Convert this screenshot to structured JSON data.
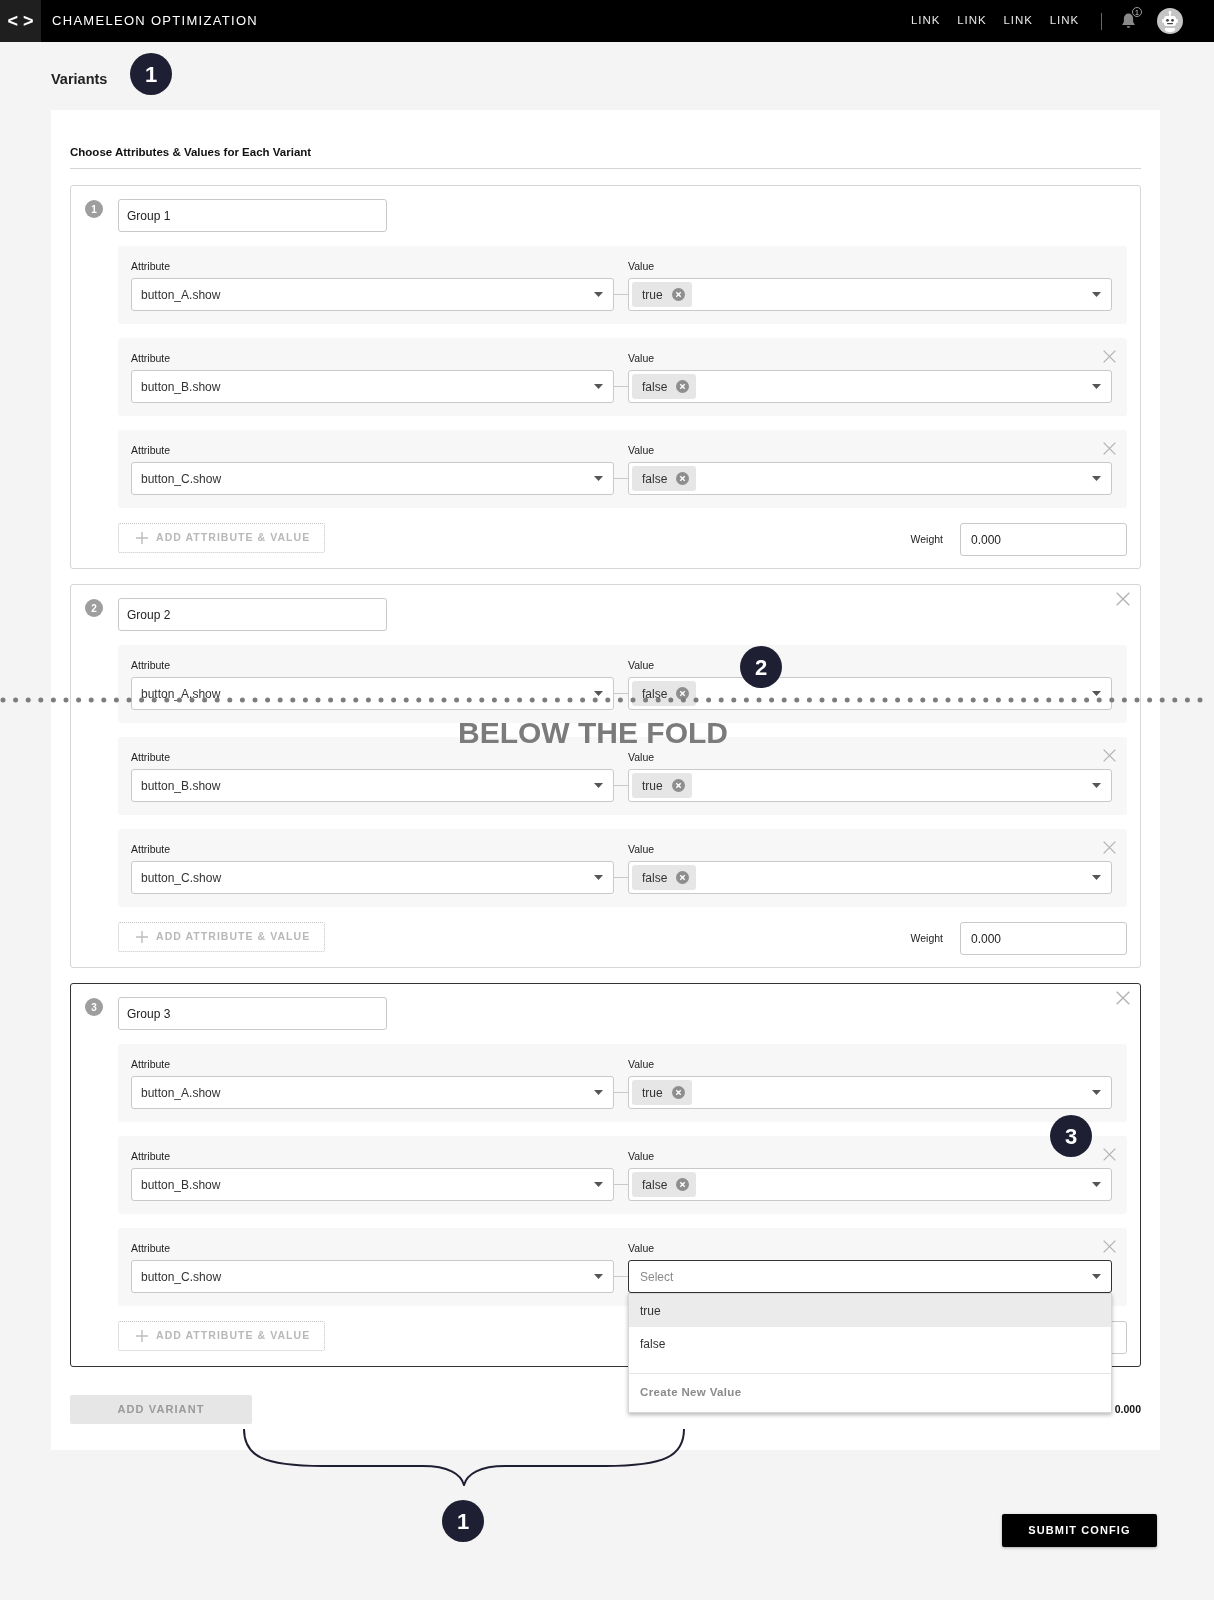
{
  "header": {
    "logo": "< >",
    "title": "CHAMELEON OPTIMIZATION",
    "links": [
      "LINK",
      "LINK",
      "LINK",
      "LINK"
    ],
    "notification_count": "1"
  },
  "page": {
    "title": "Variants"
  },
  "variants_card": {
    "heading": "Choose Attributes & Values for Each Variant",
    "groups": [
      {
        "number": "1",
        "name": "Group 1",
        "active": false,
        "removable": false,
        "rows": [
          {
            "attribute_label": "Attribute",
            "attribute": "button_A.show",
            "value_label": "Value",
            "value": "true",
            "removable": false,
            "expanded": false
          },
          {
            "attribute_label": "Attribute",
            "attribute": "button_B.show",
            "value_label": "Value",
            "value": "false",
            "removable": true,
            "expanded": false
          },
          {
            "attribute_label": "Attribute",
            "attribute": "button_C.show",
            "value_label": "Value",
            "value": "false",
            "removable": true,
            "expanded": false
          }
        ],
        "add_button": "ADD ATTRIBUTE & VALUE",
        "weight_label": "Weight",
        "weight": "0.000"
      },
      {
        "number": "2",
        "name": "Group 2",
        "active": false,
        "removable": true,
        "rows": [
          {
            "attribute_label": "Attribute",
            "attribute": "button_A.show",
            "value_label": "Value",
            "value": "false",
            "removable": false,
            "expanded": false
          },
          {
            "attribute_label": "Attribute",
            "attribute": "button_B.show",
            "value_label": "Value",
            "value": "true",
            "removable": true,
            "expanded": false
          },
          {
            "attribute_label": "Attribute",
            "attribute": "button_C.show",
            "value_label": "Value",
            "value": "false",
            "removable": true,
            "expanded": false
          }
        ],
        "add_button": "ADD ATTRIBUTE & VALUE",
        "weight_label": "Weight",
        "weight": "0.000"
      },
      {
        "number": "3",
        "name": "Group 3",
        "active": true,
        "removable": true,
        "rows": [
          {
            "attribute_label": "Attribute",
            "attribute": "button_A.show",
            "value_label": "Value",
            "value": "true",
            "removable": false,
            "expanded": false
          },
          {
            "attribute_label": "Attribute",
            "attribute": "button_B.show",
            "value_label": "Value",
            "value": "false",
            "removable": true,
            "expanded": false
          },
          {
            "attribute_label": "Attribute",
            "attribute": "button_C.show",
            "value_label": "Value",
            "placeholder": "Select",
            "removable": true,
            "expanded": true,
            "options": [
              {
                "label": "true",
                "highlighted": true
              },
              {
                "label": "false",
                "highlighted": false
              }
            ],
            "create_option": "Create New Value"
          }
        ],
        "add_button": "ADD ATTRIBUTE & VALUE"
      }
    ],
    "add_variant_button": "ADD VARIANT",
    "total_traffic_value": "0.000"
  },
  "submit_button": "SUBMIT CONFIG",
  "annotations": {
    "markers": [
      {
        "number": "1"
      },
      {
        "number": "2"
      },
      {
        "number": "3"
      },
      {
        "number": "1"
      }
    ],
    "fold_label": "BELOW THE FOLD"
  }
}
